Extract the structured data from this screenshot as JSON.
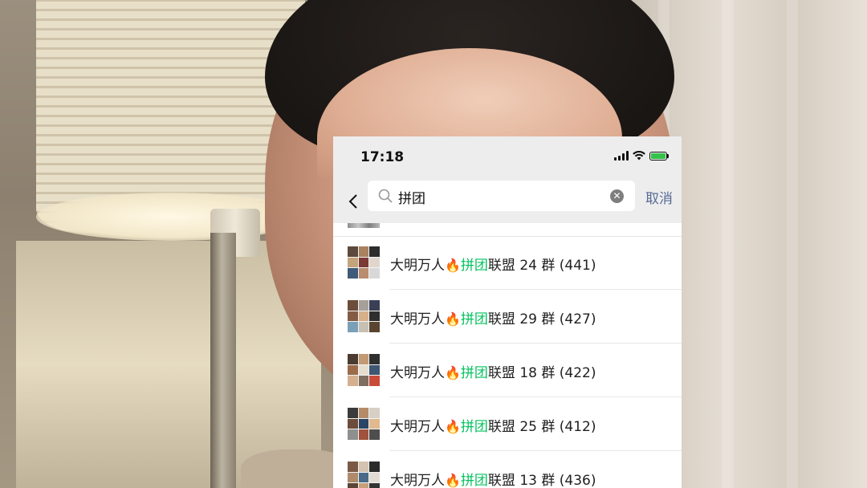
{
  "status_bar": {
    "time": "17:18"
  },
  "search": {
    "query": "拼团",
    "cancel_label": "取消"
  },
  "results": [
    {
      "prefix": "大明万人",
      "emoji": "🔥",
      "keyword": "拼团",
      "suffix": "联盟 24 群 (441)"
    },
    {
      "prefix": "大明万人",
      "emoji": "🔥",
      "keyword": "拼团",
      "suffix": "联盟 29 群 (427)"
    },
    {
      "prefix": "大明万人",
      "emoji": "🔥",
      "keyword": "拼团",
      "suffix": "联盟 18 群 (422)"
    },
    {
      "prefix": "大明万人",
      "emoji": "🔥",
      "keyword": "拼团",
      "suffix": "联盟 25 群 (412)"
    },
    {
      "prefix": "大明万人",
      "emoji": "🔥",
      "keyword": "拼团",
      "suffix": "联盟 13 群 (436)"
    }
  ],
  "colors": {
    "highlight": "#07c160",
    "cancel": "#576b95",
    "bar_bg": "#ededed"
  },
  "icons": {
    "back": "chevron-left-icon",
    "search": "search-icon",
    "clear": "clear-icon",
    "signal": "signal-icon",
    "wifi": "wifi-icon",
    "battery": "battery-charging-icon"
  }
}
